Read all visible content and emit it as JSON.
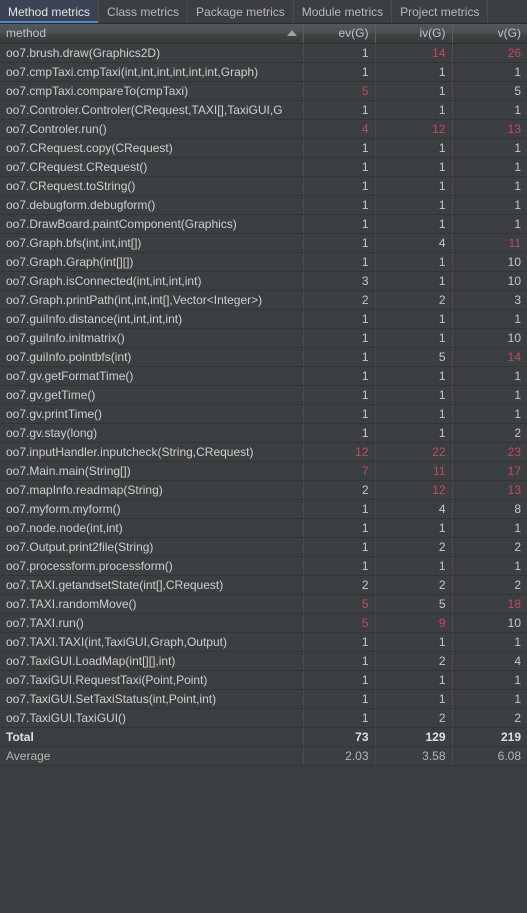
{
  "tabs": [
    {
      "label": "Method metrics",
      "active": true
    },
    {
      "label": "Class metrics",
      "active": false
    },
    {
      "label": "Package metrics",
      "active": false
    },
    {
      "label": "Module metrics",
      "active": false
    },
    {
      "label": "Project metrics",
      "active": false
    }
  ],
  "table": {
    "columns": [
      {
        "key": "method",
        "label": "method",
        "align": "left",
        "sorted": true,
        "sort_direction": "ascending"
      },
      {
        "key": "ev",
        "label": "ev(G)",
        "align": "right"
      },
      {
        "key": "iv",
        "label": "iv(G)",
        "align": "right"
      },
      {
        "key": "v",
        "label": "v(G)",
        "align": "right"
      }
    ],
    "rows": [
      {
        "method": "oo7.brush.draw(Graphics2D)",
        "ev": "1",
        "iv": "14",
        "v": "26",
        "hot": [
          "iv",
          "v"
        ]
      },
      {
        "method": "oo7.cmpTaxi.cmpTaxi(int,int,int,int,int,int,Graph)",
        "ev": "1",
        "iv": "1",
        "v": "1",
        "hot": []
      },
      {
        "method": "oo7.cmpTaxi.compareTo(cmpTaxi)",
        "ev": "5",
        "iv": "1",
        "v": "5",
        "hot": [
          "ev"
        ]
      },
      {
        "method": "oo7.Controler.Controler(CRequest,TAXI[],TaxiGUI,G",
        "ev": "1",
        "iv": "1",
        "v": "1",
        "hot": []
      },
      {
        "method": "oo7.Controler.run()",
        "ev": "4",
        "iv": "12",
        "v": "13",
        "hot": [
          "ev",
          "iv",
          "v"
        ]
      },
      {
        "method": "oo7.CRequest.copy(CRequest)",
        "ev": "1",
        "iv": "1",
        "v": "1",
        "hot": []
      },
      {
        "method": "oo7.CRequest.CRequest()",
        "ev": "1",
        "iv": "1",
        "v": "1",
        "hot": []
      },
      {
        "method": "oo7.CRequest.toString()",
        "ev": "1",
        "iv": "1",
        "v": "1",
        "hot": []
      },
      {
        "method": "oo7.debugform.debugform()",
        "ev": "1",
        "iv": "1",
        "v": "1",
        "hot": []
      },
      {
        "method": "oo7.DrawBoard.paintComponent(Graphics)",
        "ev": "1",
        "iv": "1",
        "v": "1",
        "hot": []
      },
      {
        "method": "oo7.Graph.bfs(int,int,int[])",
        "ev": "1",
        "iv": "4",
        "v": "11",
        "hot": [
          "v"
        ]
      },
      {
        "method": "oo7.Graph.Graph(int[][])",
        "ev": "1",
        "iv": "1",
        "v": "10",
        "hot": []
      },
      {
        "method": "oo7.Graph.isConnected(int,int,int,int)",
        "ev": "3",
        "iv": "1",
        "v": "10",
        "hot": []
      },
      {
        "method": "oo7.Graph.printPath(int,int,int[],Vector<Integer>)",
        "ev": "2",
        "iv": "2",
        "v": "3",
        "hot": []
      },
      {
        "method": "oo7.guiInfo.distance(int,int,int,int)",
        "ev": "1",
        "iv": "1",
        "v": "1",
        "hot": []
      },
      {
        "method": "oo7.guiInfo.initmatrix()",
        "ev": "1",
        "iv": "1",
        "v": "10",
        "hot": []
      },
      {
        "method": "oo7.guiInfo.pointbfs(int)",
        "ev": "1",
        "iv": "5",
        "v": "14",
        "hot": [
          "v"
        ]
      },
      {
        "method": "oo7.gv.getFormatTime()",
        "ev": "1",
        "iv": "1",
        "v": "1",
        "hot": []
      },
      {
        "method": "oo7.gv.getTime()",
        "ev": "1",
        "iv": "1",
        "v": "1",
        "hot": []
      },
      {
        "method": "oo7.gv.printTime()",
        "ev": "1",
        "iv": "1",
        "v": "1",
        "hot": []
      },
      {
        "method": "oo7.gv.stay(long)",
        "ev": "1",
        "iv": "1",
        "v": "2",
        "hot": []
      },
      {
        "method": "oo7.inputHandler.inputcheck(String,CRequest)",
        "ev": "12",
        "iv": "22",
        "v": "23",
        "hot": [
          "ev",
          "iv",
          "v"
        ]
      },
      {
        "method": "oo7.Main.main(String[])",
        "ev": "7",
        "iv": "11",
        "v": "17",
        "hot": [
          "ev",
          "iv",
          "v"
        ]
      },
      {
        "method": "oo7.mapInfo.readmap(String)",
        "ev": "2",
        "iv": "12",
        "v": "13",
        "hot": [
          "iv",
          "v"
        ]
      },
      {
        "method": "oo7.myform.myform()",
        "ev": "1",
        "iv": "4",
        "v": "8",
        "hot": []
      },
      {
        "method": "oo7.node.node(int,int)",
        "ev": "1",
        "iv": "1",
        "v": "1",
        "hot": []
      },
      {
        "method": "oo7.Output.print2file(String)",
        "ev": "1",
        "iv": "2",
        "v": "2",
        "hot": []
      },
      {
        "method": "oo7.processform.processform()",
        "ev": "1",
        "iv": "1",
        "v": "1",
        "hot": []
      },
      {
        "method": "oo7.TAXI.getandsetState(int[],CRequest)",
        "ev": "2",
        "iv": "2",
        "v": "2",
        "hot": []
      },
      {
        "method": "oo7.TAXI.randomMove()",
        "ev": "5",
        "iv": "5",
        "v": "18",
        "hot": [
          "ev",
          "v"
        ]
      },
      {
        "method": "oo7.TAXI.run()",
        "ev": "5",
        "iv": "9",
        "v": "10",
        "hot": [
          "ev",
          "iv"
        ]
      },
      {
        "method": "oo7.TAXI.TAXI(int,TaxiGUI,Graph,Output)",
        "ev": "1",
        "iv": "1",
        "v": "1",
        "hot": []
      },
      {
        "method": "oo7.TaxiGUI.LoadMap(int[][],int)",
        "ev": "1",
        "iv": "2",
        "v": "4",
        "hot": []
      },
      {
        "method": "oo7.TaxiGUI.RequestTaxi(Point,Point)",
        "ev": "1",
        "iv": "1",
        "v": "1",
        "hot": []
      },
      {
        "method": "oo7.TaxiGUI.SetTaxiStatus(int,Point,int)",
        "ev": "1",
        "iv": "1",
        "v": "1",
        "hot": []
      },
      {
        "method": "oo7.TaxiGUI.TaxiGUI()",
        "ev": "1",
        "iv": "2",
        "v": "2",
        "hot": []
      }
    ],
    "summary_rows": [
      {
        "method": "Total",
        "ev": "73",
        "iv": "129",
        "v": "219",
        "style": "summary"
      },
      {
        "method": "Average",
        "ev": "2.03",
        "iv": "3.58",
        "v": "6.08",
        "style": "avg"
      }
    ]
  },
  "colors": {
    "background": "#3c3f41",
    "header_text": "#c3c3c3",
    "row_text": "#c8c8c8",
    "hot_value": "#c9485b",
    "active_tab_bg": "#3b4354",
    "active_tab_underline": "#4a88c7"
  },
  "icons": {
    "sort_ascending": "sort-ascending-icon"
  }
}
